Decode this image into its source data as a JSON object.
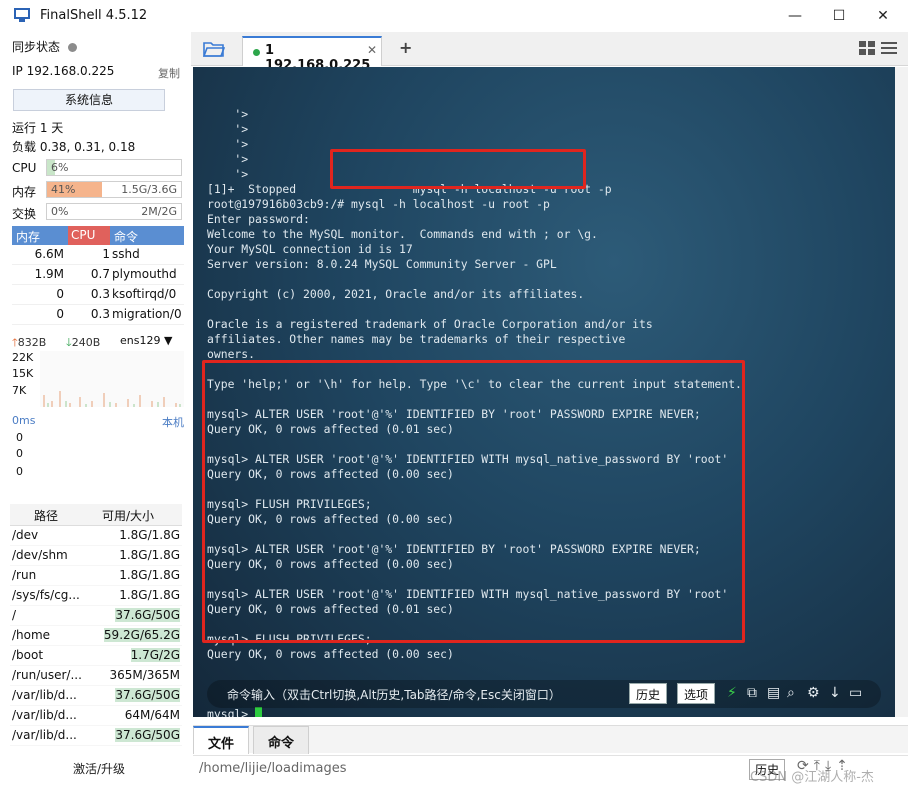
{
  "window": {
    "title": "FinalShell 4.5.12",
    "minimize": "—",
    "maximize": "☐",
    "close": "✕"
  },
  "left": {
    "sync_label": "同步状态",
    "ip_label": "IP",
    "ip_value": "192.168.0.225",
    "copy": "复制",
    "sysinfo": "系统信息",
    "uptime": "运行 1 天",
    "load": "负载 0.38, 0.31, 0.18",
    "cpu": {
      "label": "CPU",
      "value": "6%",
      "percent": 6
    },
    "mem": {
      "label": "内存",
      "value": "41%",
      "detail": "1.5G/3.6G",
      "percent": 41
    },
    "swap": {
      "label": "交换",
      "value": "0%",
      "detail": "2M/2G",
      "percent": 0
    },
    "proc_headers": [
      "内存",
      "CPU",
      "命令"
    ],
    "procs": [
      {
        "mem": "6.6M",
        "cpu": "1",
        "cmd": "sshd"
      },
      {
        "mem": "1.9M",
        "cpu": "0.7",
        "cmd": "plymouthd"
      },
      {
        "mem": "0",
        "cpu": "0.3",
        "cmd": "ksoftirqd/0"
      },
      {
        "mem": "0",
        "cpu": "0.3",
        "cmd": "migration/0"
      }
    ],
    "net": {
      "up": "832B",
      "down": "240B",
      "iface": "ens129",
      "y": [
        "22K",
        "15K",
        "7K"
      ]
    },
    "ping": {
      "ms": "0ms",
      "machine": "本机",
      "values": [
        "0",
        "0",
        "0"
      ]
    },
    "disk_headers": [
      "路径",
      "可用/大小"
    ],
    "disks": [
      {
        "path": "/dev",
        "size": "1.8G/1.8G",
        "hi": false
      },
      {
        "path": "/dev/shm",
        "size": "1.8G/1.8G",
        "hi": false
      },
      {
        "path": "/run",
        "size": "1.8G/1.8G",
        "hi": false
      },
      {
        "path": "/sys/fs/cg...",
        "size": "1.8G/1.8G",
        "hi": false
      },
      {
        "path": "/",
        "size": "37.6G/50G",
        "hi": true
      },
      {
        "path": "/home",
        "size": "59.2G/65.2G",
        "hi": true
      },
      {
        "path": "/boot",
        "size": "1.7G/2G",
        "hi": true
      },
      {
        "path": "/run/user/...",
        "size": "365M/365M",
        "hi": false
      },
      {
        "path": "/var/lib/d...",
        "size": "37.6G/50G",
        "hi": true
      },
      {
        "path": "/var/lib/d...",
        "size": "64M/64M",
        "hi": false
      },
      {
        "path": "/var/lib/d...",
        "size": "37.6G/50G",
        "hi": true
      }
    ],
    "activate": "激活/升级"
  },
  "tabs": {
    "active_label": "1 192.168.0.225",
    "close": "✕",
    "add": "+"
  },
  "terminal": {
    "lines": [
      "    '>",
      "    '>",
      "    '>",
      "    '>",
      "    '>",
      "[1]+  Stopped                 mysql -h localhost -u root -p",
      "root@197916b03cb9:/# mysql -h localhost -u root -p",
      "Enter password:",
      "Welcome to the MySQL monitor.  Commands end with ; or \\g.",
      "Your MySQL connection id is 17",
      "Server version: 8.0.24 MySQL Community Server - GPL",
      "",
      "Copyright (c) 2000, 2021, Oracle and/or its affiliates.",
      "",
      "Oracle is a registered trademark of Oracle Corporation and/or its",
      "affiliates. Other names may be trademarks of their respective",
      "owners.",
      "",
      "Type 'help;' or '\\h' for help. Type '\\c' to clear the current input statement.",
      "",
      "mysql> ALTER USER 'root'@'%' IDENTIFIED BY 'root' PASSWORD EXPIRE NEVER;",
      "Query OK, 0 rows affected (0.01 sec)",
      "",
      "mysql> ALTER USER 'root'@'%' IDENTIFIED WITH mysql_native_password BY 'root'",
      "Query OK, 0 rows affected (0.00 sec)",
      "",
      "mysql> FLUSH PRIVILEGES;",
      "Query OK, 0 rows affected (0.00 sec)",
      "",
      "mysql> ALTER USER 'root'@'%' IDENTIFIED BY 'root' PASSWORD EXPIRE NEVER;",
      "Query OK, 0 rows affected (0.00 sec)",
      "",
      "mysql> ALTER USER 'root'@'%' IDENTIFIED WITH mysql_native_password BY 'root'",
      "Query OK, 0 rows affected (0.01 sec)",
      "",
      "mysql> FLUSH PRIVILEGES;",
      "Query OK, 0 rows affected (0.00 sec)",
      ""
    ],
    "prompt": "mysql> ",
    "cmd_hint": "命令输入（双击Ctrl切换,Alt历史,Tab路径/命令,Esc关闭窗口）",
    "history_btn": "历史",
    "options_btn": "选项"
  },
  "bottom": {
    "tab_file": "文件",
    "tab_cmd": "命令",
    "path": "/home/lijie/loadimages",
    "history": "历史"
  },
  "watermark": "CSDN @江湖人称-杰",
  "colors": {
    "accent": "#3a7bd5",
    "highlight": "#e0251e",
    "cursor": "#2ecc40",
    "mem_fill": "#f5b48c",
    "cpu_fill": "#c9e6c9"
  }
}
